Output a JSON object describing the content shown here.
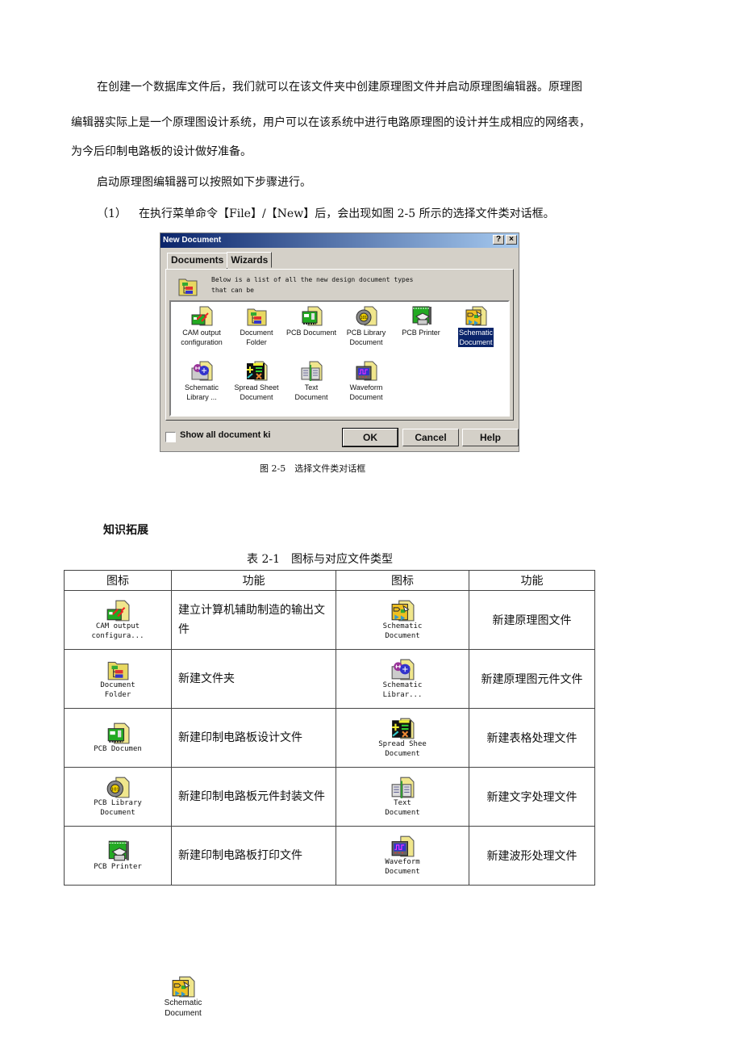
{
  "paragraphs": {
    "p1": "在创建一个数据库文件后，我们就可以在该文件夹中创建原理图文件并启动原理图编辑器。原理图",
    "p2": "编辑器实际上是一个原理图设计系统，用户可以在该系统中进行电路原理图的设计并生成相应的网络表，",
    "p3": "为今后印制电路板的设计做好准备。",
    "p4": "启动原理图编辑器可以按照如下步骤进行。",
    "step1_number": "（1）",
    "step1_text": "在执行菜单命令【File】/【New】后，会出现如图 2-5 所示的选择文件类对话框。"
  },
  "dialog": {
    "title": "New Document",
    "help_button": "?",
    "close_button": "×",
    "tabs": [
      {
        "label": "Documents",
        "active": true
      },
      {
        "label": "Wizards",
        "active": false
      }
    ],
    "description": "Below is a list of all the new design document types\nthat can be",
    "items": [
      {
        "label": "CAM output\nconfiguration",
        "icon": "cam-output-icon",
        "selected": false
      },
      {
        "label": "Document\nFolder",
        "icon": "document-folder-icon",
        "selected": false
      },
      {
        "label": "PCB Document",
        "icon": "pcb-document-icon",
        "selected": false
      },
      {
        "label": "PCB Library\nDocument",
        "icon": "pcb-library-icon",
        "selected": false
      },
      {
        "label": "PCB Printer",
        "icon": "pcb-printer-icon",
        "selected": false
      },
      {
        "label": "Schematic\nDocument",
        "icon": "schematic-document-icon",
        "selected": true
      },
      {
        "label": "Schematic\nLibrary ...",
        "icon": "schematic-library-icon",
        "selected": false
      },
      {
        "label": "Spread Sheet\nDocument",
        "icon": "spreadsheet-icon",
        "selected": false
      },
      {
        "label": "Text\nDocument",
        "icon": "text-document-icon",
        "selected": false
      },
      {
        "label": "Waveform\nDocument",
        "icon": "waveform-icon",
        "selected": false
      }
    ],
    "checkbox_label": "Show all document ki",
    "checkbox_checked": false,
    "ok_label": "OK",
    "cancel_label": "Cancel",
    "help_label": "Help"
  },
  "figure_caption": "图 2-5　选择文件类对话框",
  "section_heading": "知识拓展",
  "table": {
    "caption": "表 2-1　图标与对应文件类型",
    "headers": [
      "图标",
      "功能",
      "图标",
      "功能"
    ],
    "rows": [
      {
        "icon1_label": "CAM output\nconfigura...",
        "icon1": "cam-output-icon",
        "fn1": "建立计算机辅助制造的输出文件",
        "icon2_label": "Schematic\nDocument",
        "icon2": "schematic-document-icon",
        "fn2": "新建原理图文件"
      },
      {
        "icon1_label": "Document\nFolder",
        "icon1": "document-folder-icon",
        "fn1": "新建文件夹",
        "icon2_label": "Schematic\nLibrar...",
        "icon2": "schematic-library-icon",
        "fn2": "新建原理图元件文件"
      },
      {
        "icon1_label": "PCB Documen",
        "icon1": "pcb-document-icon",
        "fn1": "新建印制电路板设计文件",
        "icon2_label": "Spread Shee\nDocument",
        "icon2": "spreadsheet-icon",
        "fn2": "新建表格处理文件"
      },
      {
        "icon1_label": "PCB Library\nDocument",
        "icon1": "pcb-library-icon",
        "fn1": "新建印制电路板元件封装文件",
        "icon2_label": "Text\nDocument",
        "icon2": "text-document-icon",
        "fn2": "新建文字处理文件"
      },
      {
        "icon1_label": "PCB Printer",
        "icon1": "pcb-printer-icon",
        "fn1": "新建印制电路板打印文件",
        "icon2_label": "Waveform\nDocument",
        "icon2": "waveform-icon",
        "fn2": "新建波形处理文件"
      }
    ]
  },
  "standalone_icon": {
    "label": "Schematic\nDocument",
    "icon": "schematic-document-icon"
  },
  "colors": {
    "title_start": "#0a246a",
    "title_end": "#a6caf0",
    "dialog_face": "#d4d0c8",
    "selection": "#0a246a",
    "doc_yellow": "#f0e68c"
  }
}
